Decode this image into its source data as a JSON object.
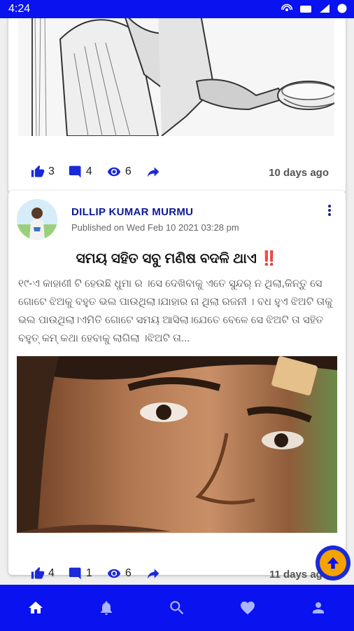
{
  "status_bar": {
    "time": "4:24"
  },
  "posts": [
    {
      "likes": "3",
      "comments": "4",
      "views": "6",
      "time_ago": "10 days ago"
    },
    {
      "author": "DILLIP KUMAR MURMU",
      "published": "Published on Wed Feb 10 2021 03:28 pm",
      "title": "ସମୟ ସହିତ ସବୁ ମଣିଷ ବଦଳି ଥାଏ",
      "title_mark": "‼️",
      "body": "୧୯-ଏ କାହାଣୀ ଟି ହେଉଛି ଧୁମା ର ।ସେ ଦେଖିବାକୁ ଏତେ ସୁନ୍ଦର୍ ନ ଥିଲା,କିନ୍ତୁ ସେ ଗୋଟେ ଝିଅକୁ ବହୁତ ଭଲ ପାଉଥିଲା।ଯାହାର ନା ଥିଲା ରଜନୀ । ବଧ ହୁଏ ଝିଅଟି ତାକୁ ଭଲ ପାଉଥିଲା।ଏମିତି ଗୋଟେ ସମୟ ଆସିଲା।ଯେତେ ବେଳେ ସେ ଝିଅଟି ତା ସହିତ ବହୁତ୍ କମ୍ କଥା ହେବାକୁ ଲାଗିଲା ।ଝିଅଟି ତା...",
      "likes": "4",
      "comments": "1",
      "views": "6",
      "time_ago": "11 days ago"
    }
  ],
  "colors": {
    "primary": "#0a12f0",
    "author": "#0b1a9a",
    "fab": "#f5a300"
  },
  "icons": [
    "like-icon",
    "comment-icon",
    "views-icon",
    "share-icon",
    "home-icon",
    "bell-icon",
    "search-icon",
    "heart-icon",
    "profile-icon",
    "arrow-up-icon"
  ]
}
